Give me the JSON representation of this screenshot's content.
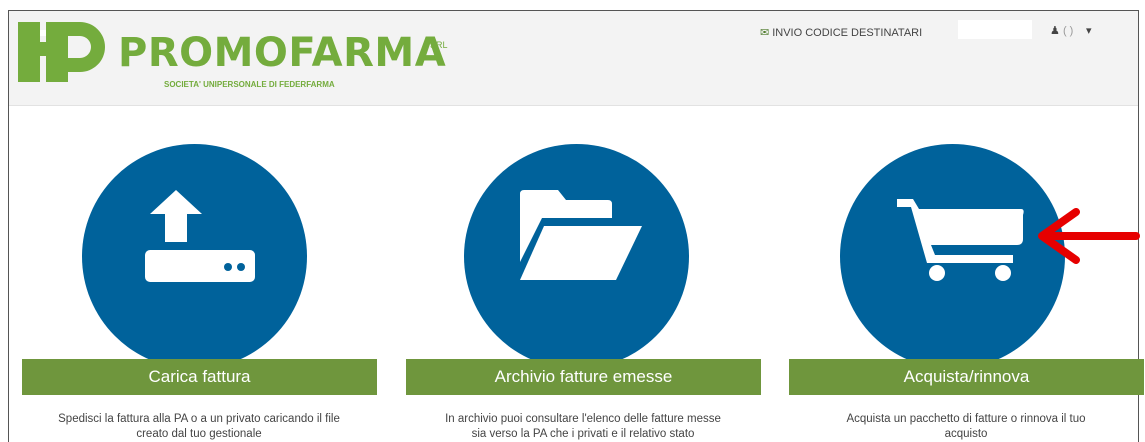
{
  "header": {
    "brand": "PROMOFARMA",
    "brand_suffix": "SRL",
    "subtitle": "SOCIETA' UNIPERSONALE DI FEDERFARMA",
    "nav_invio": "INVIO CODICE DESTINATARI",
    "user_caret": "▾",
    "user_partial": "( )"
  },
  "tiles": [
    {
      "icon": "upload-icon",
      "label": "Carica fattura",
      "description_line1": "Spedisci la fattura alla PA o a un privato caricando il file",
      "description_line2": "creato dal tuo gestionale"
    },
    {
      "icon": "folder-open-icon",
      "label": "Archivio fatture emesse",
      "description_line1": "In archivio puoi consultare l'elenco delle fatture messe",
      "description_line2": "sia verso la PA che i privati e il relativo stato"
    },
    {
      "icon": "shopping-cart-icon",
      "label": "Acquista/rinnova",
      "description_line1": "Acquista un pacchetto di fatture o rinnova il tuo",
      "description_line2": "acquisto"
    }
  ],
  "colors": {
    "brand_green": "#74ac3d",
    "tile_blue": "#00629b",
    "bar_green": "#6f963d",
    "arrow_red": "#e60000"
  }
}
